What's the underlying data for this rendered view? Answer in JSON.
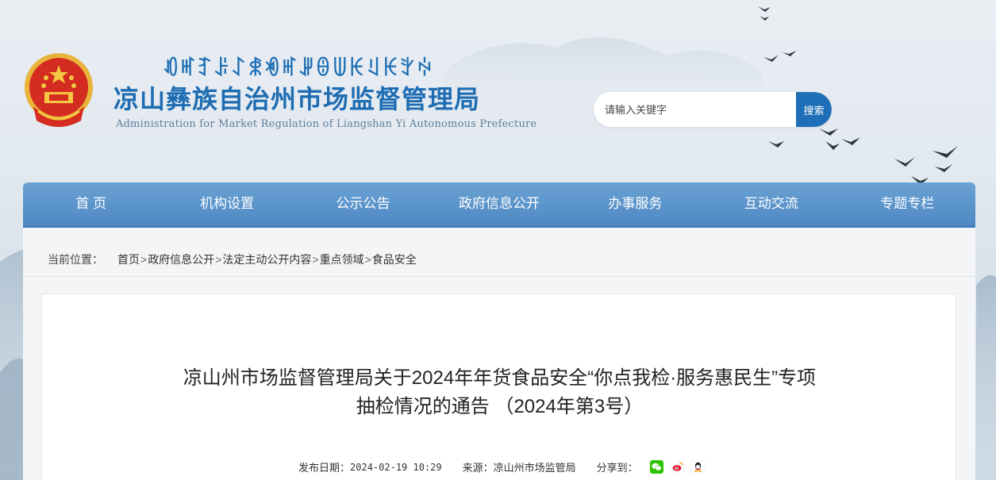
{
  "header": {
    "yi_title": "ꀒꎭꆈꌠꋍꍣꏓꎭꎼꎔꅐꀘꆹꀘꇬꏢ",
    "title": "凉山彝族自治州市场监督管理局",
    "subtitle": "Administration for Market Regulation of Liangshan Yi Autonomous Prefecture",
    "emblem_icon": "national-emblem-icon"
  },
  "search": {
    "placeholder": "请输入关键字",
    "button_label": "搜索"
  },
  "nav": {
    "items": [
      {
        "label": "首 页"
      },
      {
        "label": "机构设置"
      },
      {
        "label": "公示公告"
      },
      {
        "label": "政府信息公开"
      },
      {
        "label": "办事服务"
      },
      {
        "label": "互动交流"
      },
      {
        "label": "专题专栏"
      }
    ]
  },
  "breadcrumb": {
    "label": "当前位置：",
    "items": [
      "首页",
      "政府信息公开",
      "法定主动公开内容",
      "重点领域",
      "食品安全"
    ],
    "separator": ">"
  },
  "article": {
    "title_line1": "凉山州市场监督管理局关于2024年年货食品安全“你点我检·服务惠民生”专项",
    "title_line2": "抽检情况的通告 （2024年第3号）",
    "date_label": "发布日期：",
    "date_value": "2024-02-19 10:29",
    "source_label": "来源：",
    "source_value": "凉山州市场监管局",
    "share_label": "分享到：",
    "share_icons": [
      "wechat-icon",
      "weibo-icon",
      "qq-icon"
    ]
  },
  "colors": {
    "brand_blue": "#1e6db3",
    "nav_blue": "#5b95cc",
    "search_button": "#1f6fb8"
  }
}
